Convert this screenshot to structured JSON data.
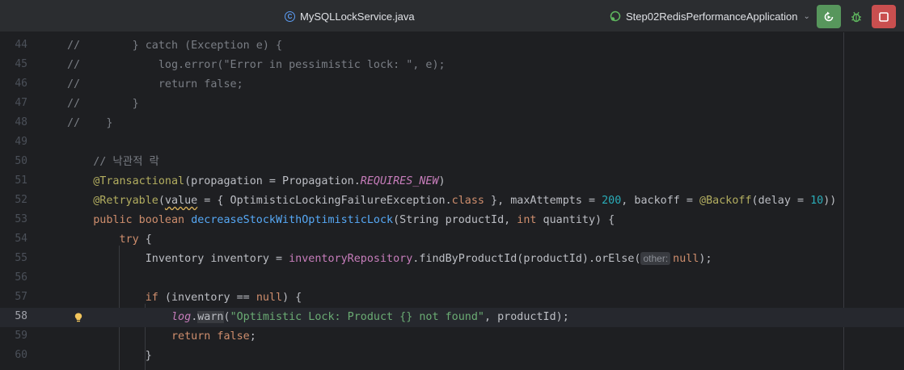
{
  "titlebar": {
    "file_title": "MySQLLockService.java",
    "run_config": "Step02RedisPerformanceApplication",
    "colors": {
      "rerun": "#57965c",
      "stop": "#c94f4f"
    }
  },
  "editor": {
    "current_line": "58",
    "lines": [
      {
        "num": "44",
        "parts": [
          "//",
          "        } catch (Exception e) {"
        ]
      },
      {
        "num": "45",
        "parts": [
          "//",
          "            log.error(\"Error in pessimistic lock: \", e);"
        ]
      },
      {
        "num": "46",
        "parts": [
          "//",
          "            return false;"
        ]
      },
      {
        "num": "47",
        "parts": [
          "//",
          "        }"
        ]
      },
      {
        "num": "48",
        "parts": [
          "//",
          "    }"
        ]
      },
      {
        "num": "49",
        "parts": []
      },
      {
        "num": "50",
        "parts": [
          "    // 낙관적 락"
        ]
      },
      {
        "num": "51",
        "parts": [
          "    ",
          "@Transactional",
          "(propagation = Propagation.",
          "REQUIRES_NEW",
          ")"
        ]
      },
      {
        "num": "52",
        "parts": [
          "    ",
          "@Retryable",
          "(",
          "value",
          " = { OptimisticLockingFailureException.",
          "class",
          " }, maxAttempts = ",
          "200",
          ", backoff = ",
          "@Backoff",
          "(delay = ",
          "10",
          "))"
        ]
      },
      {
        "num": "53",
        "parts": [
          "    ",
          "public boolean ",
          "decreaseStockWithOptimisticLock",
          "(String productId, ",
          "int",
          " quantity) {"
        ]
      },
      {
        "num": "54",
        "parts": [
          "        ",
          "try",
          " {"
        ]
      },
      {
        "num": "55",
        "parts": [
          "            Inventory inventory = ",
          "inventoryRepository",
          ".findByProductId(productId).orElse(",
          "other:",
          "null",
          ");"
        ]
      },
      {
        "num": "56",
        "parts": []
      },
      {
        "num": "57",
        "parts": [
          "            ",
          "if",
          " (inventory == ",
          "null",
          ") {"
        ]
      },
      {
        "num": "58",
        "parts": [
          "                ",
          "log",
          ".",
          "warn",
          "(",
          "\"Optimistic Lock: Product {} not found\"",
          ", productId);"
        ]
      },
      {
        "num": "59",
        "parts": [
          "                ",
          "return false",
          ";"
        ]
      },
      {
        "num": "60",
        "parts": [
          "            }"
        ]
      }
    ]
  }
}
